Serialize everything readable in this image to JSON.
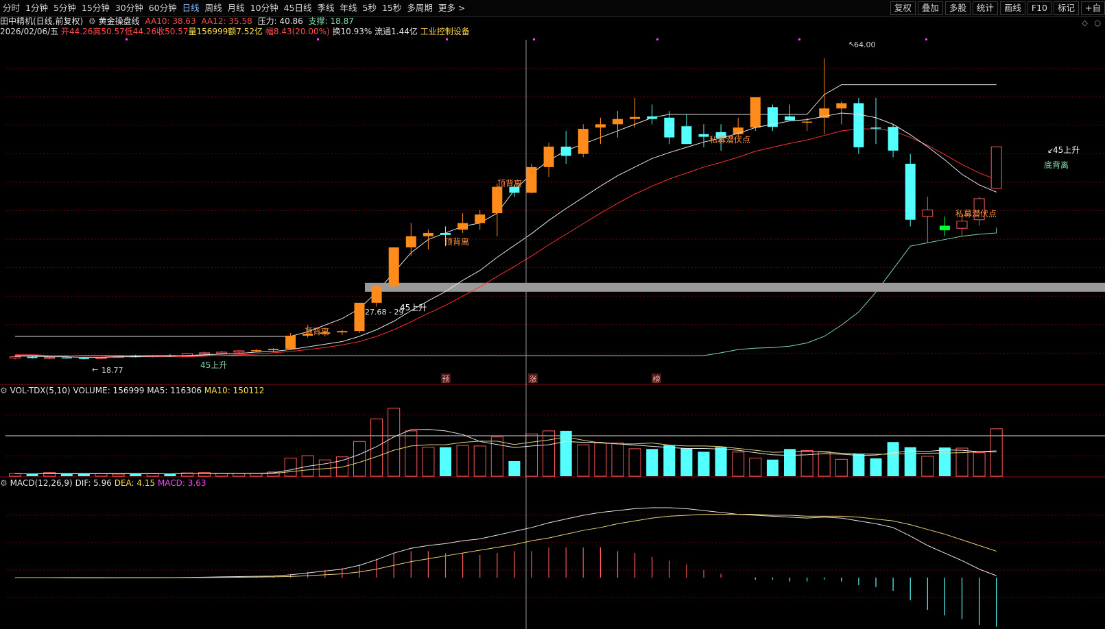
{
  "toolbar": {
    "left_items": [
      "分时",
      "1分钟",
      "5分钟",
      "15分钟",
      "30分钟",
      "60分钟",
      "日线",
      "周线",
      "月线",
      "10分钟",
      "45日线",
      "季线",
      "年线",
      "5秒",
      "15秒",
      "多周期",
      "更多 >"
    ],
    "active": "日线",
    "right_items": [
      "复权",
      "叠加",
      "多股",
      "统计",
      "画线",
      "F10",
      "标记",
      "+自"
    ]
  },
  "main_header": {
    "stock": "田中精机(日线,前复权)",
    "indicator": "黄金操盘线",
    "aa10": "AA10: 38.63",
    "aa12": "AA12: 35.58",
    "pressure": "压力: 40.86",
    "support": "支撑: 18.87"
  },
  "info_line": {
    "date": "2026/02/06/五",
    "open": "开44.26",
    "high": "高50.57",
    "low": "低44.26",
    "close": "收50.57",
    "volume": "量156999",
    "amount": "额7.52亿",
    "change": "幅8.43(20.00%)",
    "turnover": "换10.93%",
    "float": "流通1.44亿",
    "sector": "工业控制设备"
  },
  "annotations": {
    "high_price": "64.00",
    "low_price": "18.77",
    "price_box": "27.68 - 29.",
    "rise45_a": "45上升",
    "rise45_b": "45上升",
    "rise45_c": "45上升",
    "top_div_1": "顶背离",
    "top_div_2": "顶背离",
    "top_div_3": "顶背离",
    "bottom_div": "底背离",
    "private_1": "私募潜伏点",
    "private_2": "私募潜伏点",
    "tag_yu": "预",
    "tag_zhang": "涨",
    "tag_bang": "榜"
  },
  "vol_header": {
    "name": "VOL-TDX(5,10)",
    "volume": "VOLUME: 156999",
    "ma5": "MA5: 116306",
    "ma10": "MA10: 150112"
  },
  "macd_header": {
    "name": "MACD(12,26,9)",
    "dif": "DIF: 5.96",
    "dea": "DEA: 4.15",
    "macd": "MACD: 3.63"
  },
  "colors": {
    "up": "#ff5a5a",
    "down": "#54ffff",
    "orange": "#ff8c1a",
    "green": "#00ff33",
    "white_line": "#e6e6e6",
    "yellow_line": "#e6d37a",
    "magenta": "#ff44ff",
    "grid": "#6a0000"
  },
  "chart_data": [
    {
      "type": "candlestick",
      "title": "田中精机(日线,前复权)",
      "ylim": [
        17,
        66
      ],
      "series": [
        {
          "name": "candles",
          "values": [
            [
              18.5,
              18.9,
              18.3,
              18.7
            ],
            [
              18.7,
              18.8,
              18.4,
              18.5
            ],
            [
              18.5,
              18.7,
              18.3,
              18.6
            ],
            [
              18.6,
              18.8,
              18.4,
              18.5
            ],
            [
              18.5,
              18.6,
              18.3,
              18.4
            ],
            [
              18.4,
              18.7,
              18.3,
              18.6
            ],
            [
              18.6,
              18.9,
              18.5,
              18.8
            ],
            [
              18.8,
              19.0,
              18.6,
              18.7
            ],
            [
              18.7,
              19.0,
              18.6,
              18.9
            ],
            [
              18.9,
              19.1,
              18.7,
              18.8
            ],
            [
              18.8,
              19.3,
              18.7,
              19.2
            ],
            [
              19.2,
              19.5,
              19.0,
              19.3
            ],
            [
              19.3,
              19.6,
              19.1,
              19.4
            ],
            [
              19.4,
              19.7,
              19.2,
              19.6
            ],
            [
              19.6,
              19.9,
              19.4,
              19.7
            ],
            [
              19.7,
              20.0,
              19.5,
              19.9
            ],
            [
              19.9,
              22.3,
              19.8,
              21.9
            ],
            [
              21.9,
              23.5,
              21.6,
              22.2
            ],
            [
              22.2,
              22.6,
              21.8,
              22.4
            ],
            [
              22.4,
              22.8,
              22.0,
              22.6
            ],
            [
              22.6,
              25.6,
              22.3,
              26.9
            ],
            [
              26.9,
              29.4,
              26.3,
              29.4
            ],
            [
              29.4,
              35.3,
              29.0,
              35.3
            ],
            [
              35.3,
              39.0,
              34.0,
              37.0
            ],
            [
              37.0,
              38.0,
              35.0,
              37.5
            ],
            [
              37.5,
              38.5,
              35.5,
              37.2
            ],
            [
              38.0,
              40.5,
              37.5,
              39.0
            ],
            [
              39.0,
              41.0,
              38.0,
              40.3
            ],
            [
              40.5,
              45.0,
              37.0,
              44.5
            ],
            [
              44.5,
              44.8,
              43.0,
              43.6
            ],
            [
              43.6,
              48.0,
              43.5,
              47.5
            ],
            [
              47.5,
              51.2,
              46.0,
              50.6
            ],
            [
              50.6,
              53.0,
              48.0,
              49.2
            ],
            [
              49.5,
              54.0,
              49.0,
              53.3
            ],
            [
              53.5,
              55.0,
              51.0,
              54.0
            ],
            [
              54.0,
              56.0,
              52.0,
              54.8
            ],
            [
              54.8,
              58.0,
              53.5,
              55.1
            ],
            [
              55.2,
              57.0,
              54.0,
              54.8
            ],
            [
              55.0,
              56.0,
              51.0,
              52.0
            ],
            [
              53.7,
              55.5,
              51.0,
              51.0
            ],
            [
              52.5,
              54.0,
              50.5,
              52.1
            ],
            [
              52.8,
              54.0,
              50.0,
              51.9
            ],
            [
              52.5,
              55.0,
              52.0,
              53.5
            ],
            [
              53.5,
              57.3,
              53.0,
              58.1
            ],
            [
              56.6,
              57.0,
              53.0,
              53.6
            ],
            [
              55.2,
              57.0,
              54.5,
              54.6
            ],
            [
              54.3,
              55.0,
              53.0,
              54.4
            ],
            [
              55.0,
              64.0,
              52.5,
              56.4
            ],
            [
              56.4,
              57.5,
              54.0,
              57.2
            ],
            [
              57.2,
              58.0,
              49.5,
              50.5
            ],
            [
              53.5,
              58.0,
              51.0,
              53.4
            ],
            [
              53.6,
              54.0,
              49.0,
              50.0
            ],
            [
              48.0,
              49.5,
              38.5,
              39.5
            ],
            [
              40.0,
              43.0,
              36.0,
              41.0
            ],
            [
              38.6,
              40.0,
              37.0,
              37.9
            ],
            [
              38.2,
              40.5,
              37.0,
              39.3
            ],
            [
              39.5,
              43.0,
              38.6,
              42.7
            ],
            [
              44.26,
              50.57,
              44.26,
              50.57
            ]
          ]
        },
        {
          "name": "AA10",
          "values": [
            18.8,
            18.8,
            18.7,
            18.7,
            18.6,
            18.6,
            18.7,
            18.7,
            18.8,
            18.8,
            18.9,
            19.0,
            19.1,
            19.2,
            19.4,
            19.5,
            19.8,
            20.2,
            20.6,
            21.0,
            21.8,
            22.8,
            24.1,
            25.7,
            27.2,
            28.6,
            30.3,
            31.8,
            33.8,
            35.6,
            37.4,
            39.4,
            41.2,
            42.9,
            44.6,
            46.2,
            47.5,
            48.8,
            49.7,
            50.5,
            51.3,
            51.9,
            52.6,
            53.5,
            54.0,
            54.5,
            54.7,
            55.2,
            55.7,
            55.5,
            55.0,
            54.0,
            52.4,
            50.6,
            48.6,
            46.4,
            44.8,
            43.7
          ]
        },
        {
          "name": "AA12",
          "values": [
            19.0,
            19.0,
            18.9,
            18.9,
            18.8,
            18.8,
            18.7,
            18.7,
            18.7,
            18.7,
            18.7,
            18.8,
            18.9,
            19.0,
            19.1,
            19.3,
            19.5,
            19.8,
            20.1,
            20.5,
            21.0,
            21.8,
            22.8,
            24.0,
            25.3,
            26.5,
            27.9,
            29.3,
            30.9,
            32.4,
            34.0,
            35.7,
            37.3,
            38.9,
            40.5,
            42.0,
            43.4,
            44.6,
            45.7,
            46.6,
            47.5,
            48.2,
            49.0,
            49.9,
            50.5,
            51.1,
            51.6,
            52.3,
            53.0,
            53.3,
            53.3,
            53.0,
            52.0,
            50.8,
            49.4,
            47.9,
            46.6,
            45.6
          ]
        }
      ]
    },
    {
      "type": "bar",
      "title": "VOL-TDX(5,10)",
      "ylim": [
        0,
        270000
      ],
      "series": [
        {
          "name": "VOLUME",
          "values": [
            9000,
            8000,
            12000,
            7000,
            9000,
            8000,
            7000,
            10000,
            9000,
            8000,
            11000,
            12000,
            10000,
            9000,
            10000,
            14000,
            60000,
            68000,
            54000,
            64000,
            115000,
            190000,
            225000,
            150000,
            96000,
            96000,
            102000,
            100000,
            130000,
            50000,
            140000,
            150000,
            150000,
            104000,
            110000,
            110000,
            91000,
            90000,
            103000,
            93000,
            81000,
            96000,
            80000,
            60000,
            55000,
            90000,
            85000,
            82000,
            56000,
            74000,
            59000,
            113000,
            96000,
            66000,
            95000,
            93000,
            78000,
            157000
          ]
        },
        {
          "name": "MA5",
          "values": [
            8000,
            8000,
            9000,
            9000,
            9000,
            9000,
            9000,
            9000,
            9000,
            8000,
            9000,
            10000,
            10000,
            10000,
            10000,
            11000,
            21000,
            33000,
            41000,
            52000,
            72000,
            98000,
            130000,
            154000,
            155000,
            150000,
            138000,
            115000,
            105000,
            95000,
            100000,
            104000,
            115000,
            112000,
            112000,
            107000,
            103000,
            99000,
            95000,
            92000,
            92000,
            90000,
            86000,
            78000,
            71000,
            69000,
            71000,
            75000,
            73000,
            69000,
            70000,
            77000,
            84000,
            82000,
            87000,
            86000,
            81000,
            84000
          ]
        },
        {
          "name": "MA10",
          "values": [
            8000,
            8000,
            8000,
            8000,
            8000,
            8000,
            8000,
            8000,
            8000,
            8000,
            9000,
            9000,
            9000,
            9000,
            9000,
            9000,
            15000,
            21000,
            25000,
            30000,
            46000,
            65000,
            86000,
            100000,
            104000,
            104000,
            112000,
            116000,
            116000,
            105000,
            113000,
            120000,
            130000,
            119000,
            110000,
            107000,
            107000,
            110000,
            103000,
            100000,
            100000,
            98000,
            92000,
            86000,
            79000,
            81000,
            82000,
            80000,
            76000,
            74000,
            73000,
            73000,
            75000,
            76000,
            77000,
            78000,
            81000,
            80000
          ]
        }
      ]
    },
    {
      "type": "line",
      "title": "MACD(12,26,9)",
      "ylim": [
        -5,
        9.5
      ],
      "series": [
        {
          "name": "DIF",
          "values": [
            0.0,
            0.0,
            0.0,
            -0.02,
            -0.03,
            -0.03,
            -0.02,
            -0.02,
            -0.01,
            0.0,
            0.02,
            0.05,
            0.08,
            0.11,
            0.14,
            0.17,
            0.3,
            0.5,
            0.7,
            0.9,
            1.3,
            1.9,
            2.6,
            3.1,
            3.4,
            3.6,
            3.9,
            4.1,
            4.5,
            4.9,
            5.3,
            5.8,
            6.2,
            6.6,
            6.9,
            7.1,
            7.3,
            7.4,
            7.4,
            7.3,
            7.1,
            6.9,
            6.7,
            6.6,
            6.5,
            6.4,
            6.3,
            6.4,
            6.3,
            6.0,
            5.7,
            5.3,
            4.4,
            3.4,
            2.6,
            1.8,
            0.9,
            0.2,
            -0.2,
            0.1
          ]
        },
        {
          "name": "DEA",
          "values": [
            0.0,
            0.0,
            0.0,
            0.0,
            -0.01,
            -0.01,
            -0.02,
            -0.02,
            -0.02,
            -0.01,
            0.0,
            0.01,
            0.02,
            0.04,
            0.06,
            0.08,
            0.12,
            0.2,
            0.3,
            0.4,
            0.6,
            0.9,
            1.3,
            1.7,
            2.0,
            2.3,
            2.6,
            2.9,
            3.2,
            3.5,
            3.9,
            4.2,
            4.6,
            5.0,
            5.3,
            5.7,
            6.0,
            6.3,
            6.5,
            6.6,
            6.7,
            6.7,
            6.7,
            6.7,
            6.6,
            6.6,
            6.5,
            6.5,
            6.5,
            6.4,
            6.2,
            6.0,
            5.6,
            5.1,
            4.6,
            4.0,
            3.4,
            2.8,
            2.3,
            1.9
          ]
        }
      ]
    }
  ]
}
